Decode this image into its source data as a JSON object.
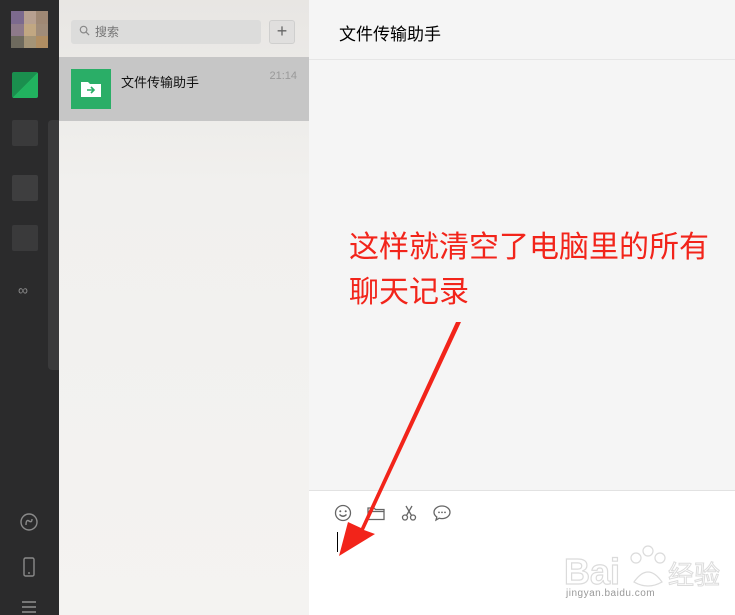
{
  "sidebar": {
    "avatar_colors": [
      "#7c6a8e",
      "#b7a090",
      "#9f8874",
      "#8e7a8a",
      "#c1a782",
      "#a08c79",
      "#6e6a5e",
      "#a49477",
      "#b08e63"
    ],
    "nav_block_colors": [
      "#1fa15a",
      "#4a4a4b",
      "#4a4a4b",
      "#3e3e3f",
      "#3e3e3f"
    ],
    "bottom_icons": [
      "mini-program-icon",
      "phone-icon",
      "menu-icon"
    ]
  },
  "search": {
    "placeholder": "搜索"
  },
  "add_button": {
    "label": "+"
  },
  "chat_list": [
    {
      "name": "文件传输助手",
      "time": "21:14",
      "avatar_color": "#2aae67"
    }
  ],
  "chat": {
    "title": "文件传输助手",
    "annotation": "这样就清空了电脑里的所有聊天记录"
  },
  "toolbar": {
    "icons": [
      "emoji-icon",
      "folder-icon",
      "scissors-icon",
      "chat-history-icon"
    ]
  },
  "watermark": {
    "brand": "Baidu经验",
    "url": "jingyan.baidu.com"
  },
  "colors": {
    "accent": "#2aae67",
    "annotation": "#f2241a"
  }
}
